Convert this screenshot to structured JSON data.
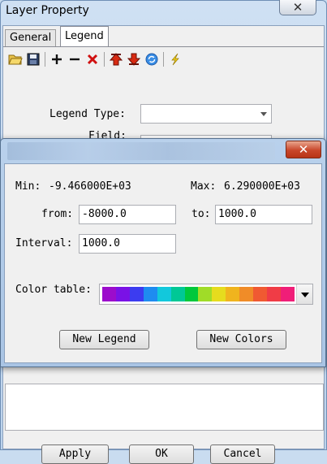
{
  "main_window": {
    "title": "Layer Property",
    "close_glyph": "✕",
    "tabs": [
      {
        "label": "General"
      },
      {
        "label": "Legend"
      }
    ],
    "toolbar_icons": [
      "open-folder-icon",
      "save-icon",
      "add-icon",
      "remove-icon",
      "delete-icon",
      "move-up-icon",
      "move-down-icon",
      "refresh-icon",
      "lightning-icon"
    ],
    "legend_type_label": "Legend Type:",
    "field_label": "Field:",
    "legend_type_value": "",
    "field_value": "",
    "apply_label": "Apply",
    "ok_label": "OK",
    "cancel_label": "Cancel"
  },
  "dialog": {
    "close_glyph": "✕",
    "min_label": "Min:",
    "min_value": "-9.466000E+03",
    "max_label": "Max:",
    "max_value": "6.290000E+03",
    "from_label": "from:",
    "from_value": "-8000.0",
    "to_label": "to:",
    "to_value": "1000.0",
    "interval_label": "Interval:",
    "interval_value": "1000.0",
    "color_table_label": "Color table:",
    "color_table_colors": [
      "#9c0ccc",
      "#7a12e6",
      "#3c3cf0",
      "#1e8cf0",
      "#12c8dc",
      "#00c896",
      "#00c83c",
      "#a0dc28",
      "#e6dc1e",
      "#f0b41e",
      "#f08c28",
      "#f05a32",
      "#f03c46",
      "#f01e78"
    ],
    "new_legend_label": "New Legend",
    "new_colors_label": "New Colors"
  }
}
